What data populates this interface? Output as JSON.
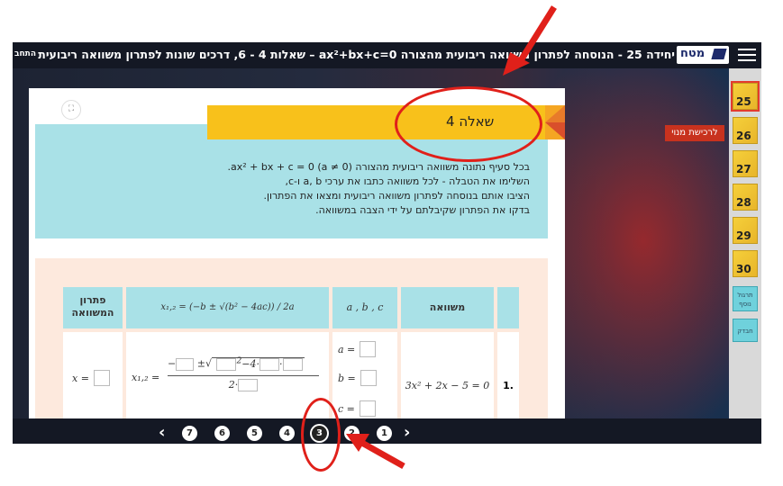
{
  "topbar": {
    "title": "יחידה 25 - הנוסחה לפתרון משוואה ריבועית מהצורה ax²+bx+c=0 – שאלות 4 - 6, דרכים שונות לפתרון משוואה ריבועית",
    "logo_text": "מטח",
    "exit_label": "התחב"
  },
  "sidebar": {
    "units": [
      "25",
      "26",
      "27",
      "28",
      "29",
      "30"
    ],
    "extra_practice": "תרגול נוסף",
    "check": "חבדק"
  },
  "main_menu_button": "לרכישת מנוי",
  "question": {
    "title": "שאלה 4",
    "instructions": [
      "בכל סעיף נתונה משוואה ריבועית מהצורה ax² + bx + c = 0  (a ≠ 0).",
      "השלימו את הטבלה - לכל משוואה כתבו את ערכי a, b ו-c,",
      "הציבו אותם בנוסחה לפתרון משוואה ריבועית ומצאו את הפתרון.",
      "בדקו את הפתרון שקיבלתם על ידי הצבה במשוואה."
    ]
  },
  "table": {
    "headers": {
      "equation": "משוואה",
      "abc": "a , b , c",
      "formula": "x₁,₂ = (−b ± √(b² − 4ac)) / 2a",
      "solution": "פתרון המשוואה"
    },
    "rows": [
      {
        "number": "1.",
        "equation": "3x² + 2x − 5 = 0",
        "a_label": "a =",
        "b_label": "b =",
        "c_label": "c =",
        "formula_prefix": "x₁,₂ =",
        "formula_numerator_text": "−▢ ± √(▢² − 4·▢·▢)",
        "formula_denominator_text": "2·▢",
        "solution_label": "x ="
      }
    ]
  },
  "pagination": {
    "pages": [
      "7",
      "6",
      "5",
      "4",
      "3",
      "2",
      "1"
    ],
    "active": "3",
    "prev": "‹",
    "next": "›"
  },
  "colors": {
    "annotation_red": "#e0201a",
    "banner_yellow": "#f8c11b",
    "teal": "#a9e1e7",
    "peach": "#fde9dd"
  }
}
